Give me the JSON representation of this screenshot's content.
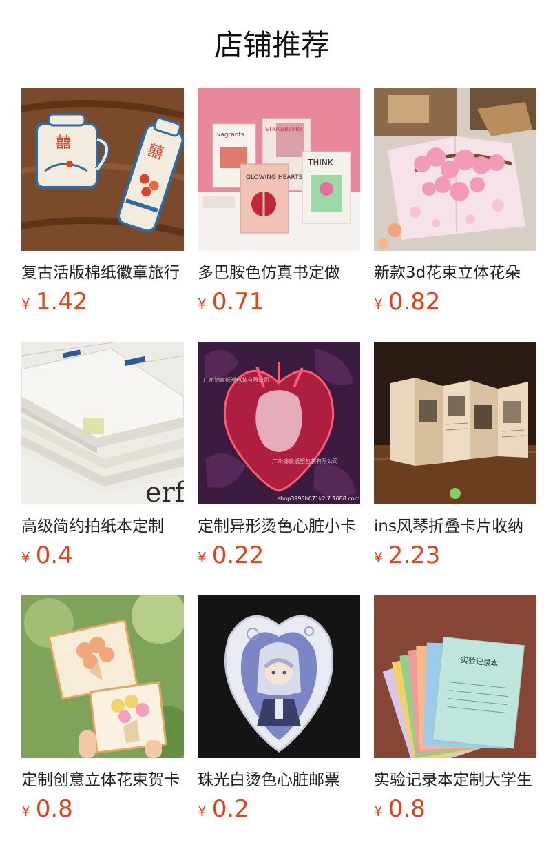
{
  "header": {
    "title": "店铺推荐"
  },
  "currency_symbol": "¥",
  "products": [
    {
      "name": "复古活版棉纸徽章旅行",
      "price": "1.42",
      "image": "retro-mug-thermos-stickers"
    },
    {
      "name": "多巴胺色仿真书定做",
      "price": "0.71",
      "image": "colorful-mini-books"
    },
    {
      "name": "新款3d花束立体花朵",
      "price": "0.82",
      "image": "cherry-blossom-popup-card"
    },
    {
      "name": "高级简约拍纸本定制",
      "price": "0.4",
      "image": "stacked-notepads"
    },
    {
      "name": "定制异形烫色心脏小卡",
      "price": "0.22",
      "image": "red-glowing-heart-card"
    },
    {
      "name": "ins风琴折叠卡片收纳",
      "price": "2.23",
      "image": "accordion-photo-cards"
    },
    {
      "name": "定制创意立体花束贺卡",
      "price": "0.8",
      "image": "flower-bouquet-popup-cards"
    },
    {
      "name": "珠光白烫色心脏邮票",
      "price": "0.2",
      "image": "anime-heart-sticker"
    },
    {
      "name": "实验记录本定制大学生",
      "price": "0.8",
      "image": "colorful-notebooks-fan"
    }
  ],
  "image_text": {
    "book_1": "vagrants",
    "book_2": "GLOWING HEARTS",
    "book_3": "THINK",
    "book_4": "STRAWBERRY",
    "notepad_text": "erfe",
    "watermark_top": "广州锦宸纸塑包装有限公司",
    "watermark_bottom": "广州锦宸纸塑包装有限公司",
    "shop_url": "shop3993b671k2i7.1688.com",
    "notebook_title": "实验记录本"
  }
}
